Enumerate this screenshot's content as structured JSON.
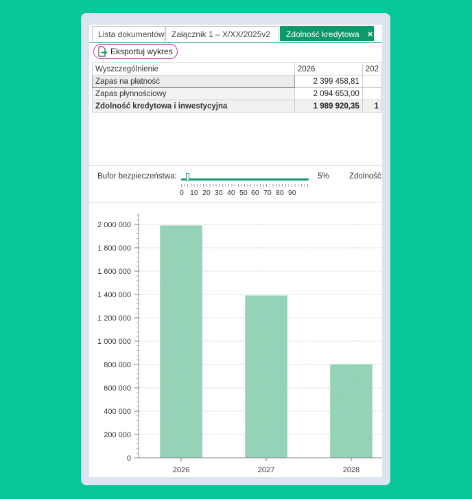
{
  "tabs": [
    {
      "label": "Lista dokumentów"
    },
    {
      "label": "Załącznik 1 – X/XX/2025v2"
    },
    {
      "label": "Zdolność kredytowa",
      "close": "×"
    }
  ],
  "toolbar": {
    "export_label": "Eksportuj wykres",
    "export_icon": "export-file-icon"
  },
  "grid": {
    "headers": [
      "Wyszczególnienie",
      "2026",
      "202"
    ],
    "rows": [
      {
        "label": "Zapas na płatność",
        "v2026": "2 399 458,81",
        "v2027": ""
      },
      {
        "label": "Zapas płynnościowy",
        "v2026": "2 094 653,00",
        "v2027": ""
      },
      {
        "label": "Zdolność kredytowa i inwestycyjna",
        "v2026": "1 989 920,35",
        "v2027": "1"
      }
    ]
  },
  "slider": {
    "label": "Bufor bezpieczeństwa:",
    "value_text": "5%",
    "value": 5,
    "min": 0,
    "max": 100,
    "tick_labels": [
      "0",
      "10",
      "20",
      "30",
      "40",
      "50",
      "60",
      "70",
      "80",
      "90"
    ],
    "right_label": "Zdolność k"
  },
  "colors": {
    "accent": "#0d9a6a",
    "bar": "#8ecfb2",
    "background": "#07c69a",
    "highlight": "#c22fb4"
  },
  "chart_data": {
    "type": "bar",
    "categories": [
      "2026",
      "2027",
      "2028"
    ],
    "values": [
      1990000,
      1390000,
      800000
    ],
    "ylim": [
      0,
      2100000
    ],
    "yticks": [
      0,
      200000,
      400000,
      600000,
      800000,
      1000000,
      1200000,
      1400000,
      1600000,
      1800000,
      2000000
    ],
    "ytick_labels": [
      "0",
      "200 000",
      "400 000",
      "600 000",
      "800 000",
      "1 000 000",
      "1 200 000",
      "1 400 000",
      "1 600 000",
      "1 800 000",
      "2 000 000"
    ],
    "grid": true,
    "title": "",
    "xlabel": "",
    "ylabel": ""
  }
}
